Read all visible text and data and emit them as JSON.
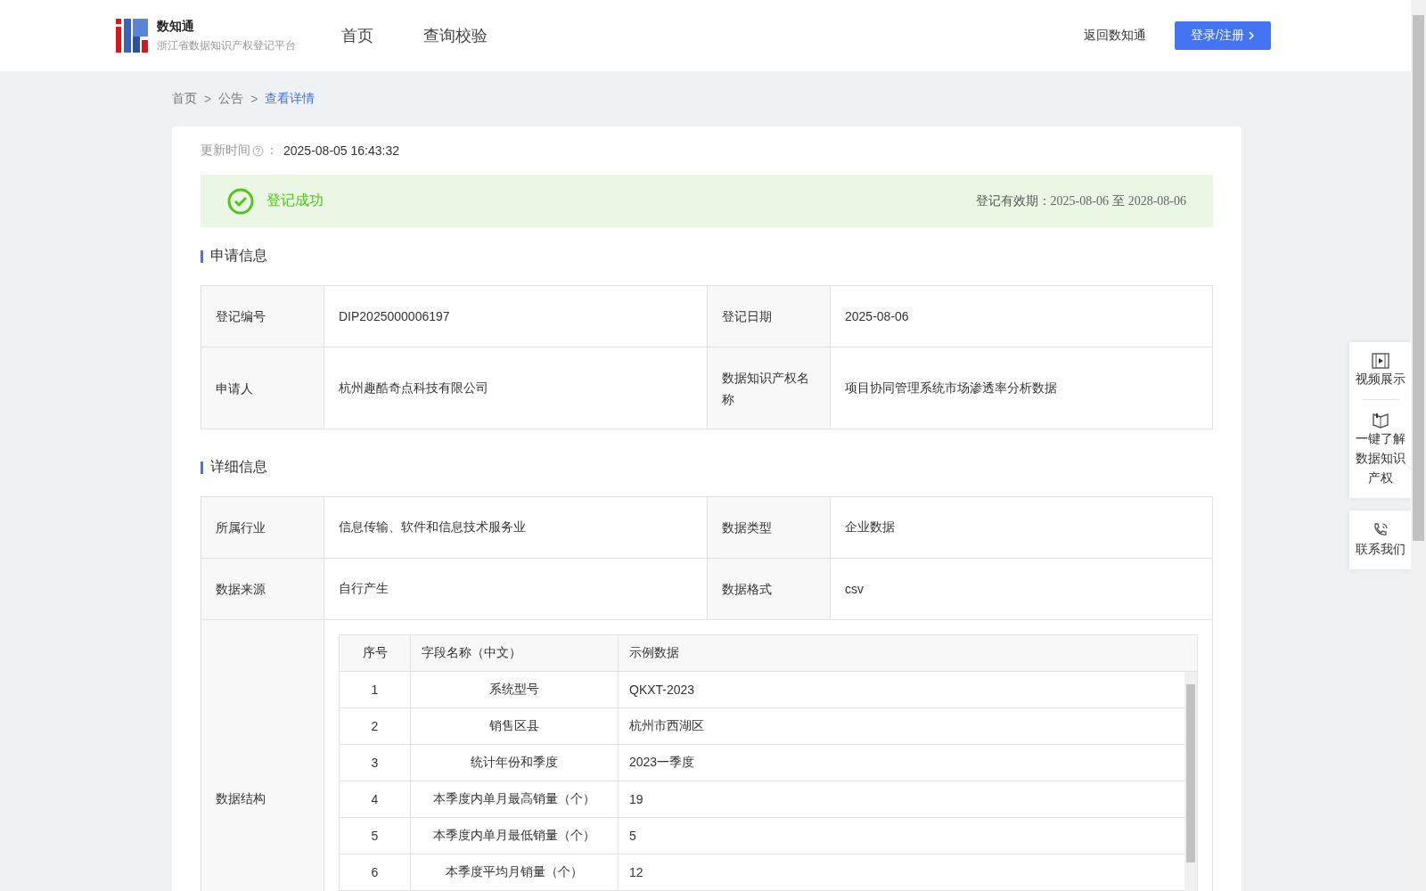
{
  "header": {
    "logo_title": "数知通",
    "logo_subtitle": "浙江省数据知识产权登记平台",
    "nav": [
      {
        "label": "首页",
        "selected": false
      },
      {
        "label": "查询校验",
        "selected": false
      }
    ],
    "back_link": "返回数知通",
    "login_button": "登录/注册"
  },
  "breadcrumb_separator": ">",
  "breadcrumb": [
    {
      "label": "首页",
      "selected": false
    },
    {
      "label": "公告",
      "selected": false
    },
    {
      "label": "查看详情",
      "selected": true
    }
  ],
  "update_time": {
    "label": "更新时间",
    "colon": "：",
    "value": "2025-08-05 16:43:32"
  },
  "status": {
    "text": "登记成功",
    "validity_label": "登记有效期：",
    "validity_from": "2025-08-06",
    "validity_sep": "至",
    "validity_to": "2028-08-06"
  },
  "application_section": {
    "title": "申请信息",
    "rows": [
      [
        {
          "label": "登记编号",
          "value": "DIP2025000006197"
        },
        {
          "label": "登记日期",
          "value": "2025-08-06"
        }
      ],
      [
        {
          "label": "申请人",
          "value": "杭州趣酷奇点科技有限公司"
        },
        {
          "label": "数据知识产权名称",
          "value": "项目协同管理系统市场渗透率分析数据"
        }
      ]
    ]
  },
  "detail_section": {
    "title": "详细信息",
    "rows": [
      [
        {
          "label": "所属行业",
          "value": "信息传输、软件和信息技术服务业"
        },
        {
          "label": "数据类型",
          "value": "企业数据"
        }
      ],
      [
        {
          "label": "数据来源",
          "value": "自行产生"
        },
        {
          "label": "数据格式",
          "value": "csv"
        }
      ]
    ],
    "structure_label": "数据结构",
    "structure_table": {
      "columns": [
        "序号",
        "字段名称（中文）",
        "示例数据"
      ],
      "rows": [
        [
          "1",
          "系统型号",
          "QKXT-2023"
        ],
        [
          "2",
          "销售区县",
          "杭州市西湖区"
        ],
        [
          "3",
          "统计年份和季度",
          "2023一季度"
        ],
        [
          "4",
          "本季度内单月最高销量（个）",
          "19"
        ],
        [
          "5",
          "本季度内单月最低销量（个）",
          "5"
        ],
        [
          "6",
          "本季度平均月销量（个）",
          "12"
        ]
      ]
    }
  },
  "side_panel": [
    {
      "label": "视频展示",
      "kind": "video"
    },
    {
      "label": "一键了解数据知识产权",
      "kind": "book"
    },
    {
      "label": "联系我们",
      "kind": "phone"
    }
  ]
}
